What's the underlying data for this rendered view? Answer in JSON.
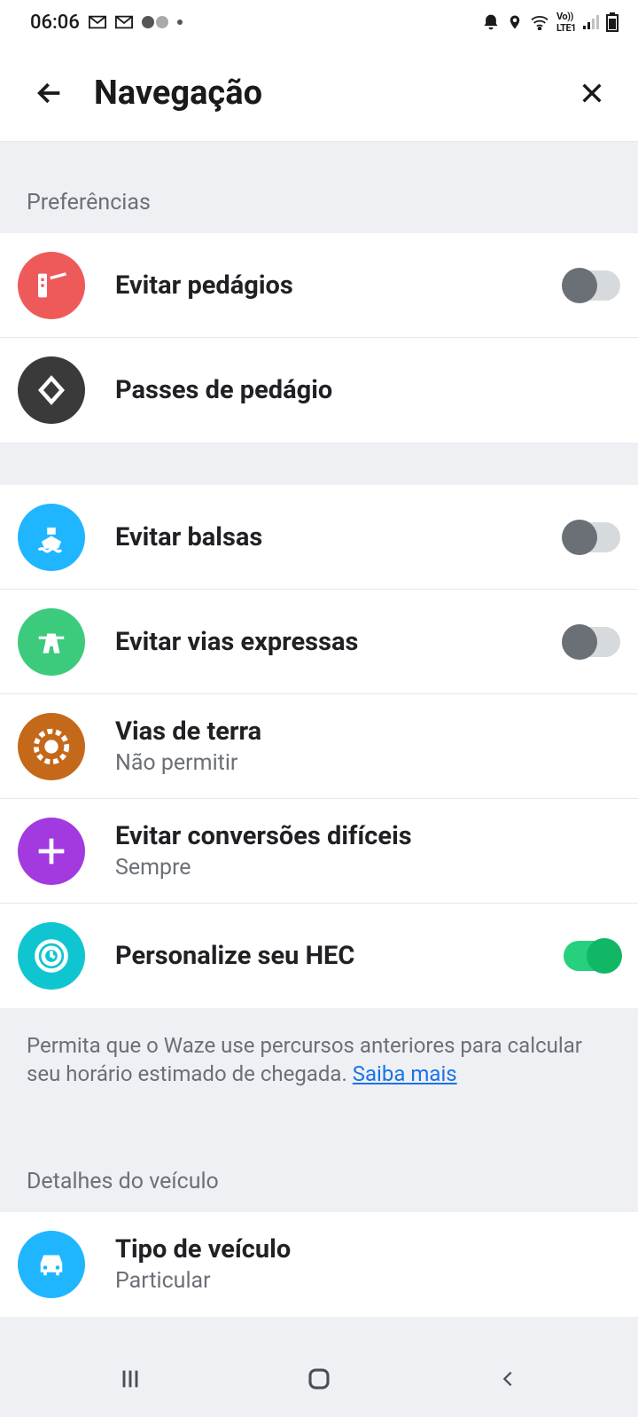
{
  "status": {
    "time": "06:06"
  },
  "header": {
    "title": "Navegação"
  },
  "sections": {
    "prefs_label": "Preferências",
    "vehicle_label": "Detalhes do veículo"
  },
  "items": {
    "tolls": {
      "label": "Evitar pedágios",
      "toggle": "off",
      "icon_bg": "#ee5a5a"
    },
    "toll_passes": {
      "label": "Passes de pedágio",
      "icon_bg": "#3a3a3a"
    },
    "ferries": {
      "label": "Evitar balsas",
      "toggle": "off",
      "icon_bg": "#1fb6ff"
    },
    "expressways": {
      "label": "Evitar vias expressas",
      "toggle": "off",
      "icon_bg": "#3ccb7c"
    },
    "dirt": {
      "label": "Vias de terra",
      "sub": "Não permitir",
      "icon_bg": "#c4691a"
    },
    "hard_turns": {
      "label": "Evitar conversões difíceis",
      "sub": "Sempre",
      "icon_bg": "#a23ae0"
    },
    "hec": {
      "label": "Personalize seu HEC",
      "toggle": "on",
      "icon_bg": "#0fc6d0"
    },
    "vehicle_type": {
      "label": "Tipo de veículo",
      "sub": "Particular",
      "icon_bg": "#1fb6ff"
    }
  },
  "hec_desc": {
    "text": "Permita que o Waze use percursos anteriores para calcular seu horário estimado de chegada. ",
    "link_text": "Saiba mais"
  }
}
